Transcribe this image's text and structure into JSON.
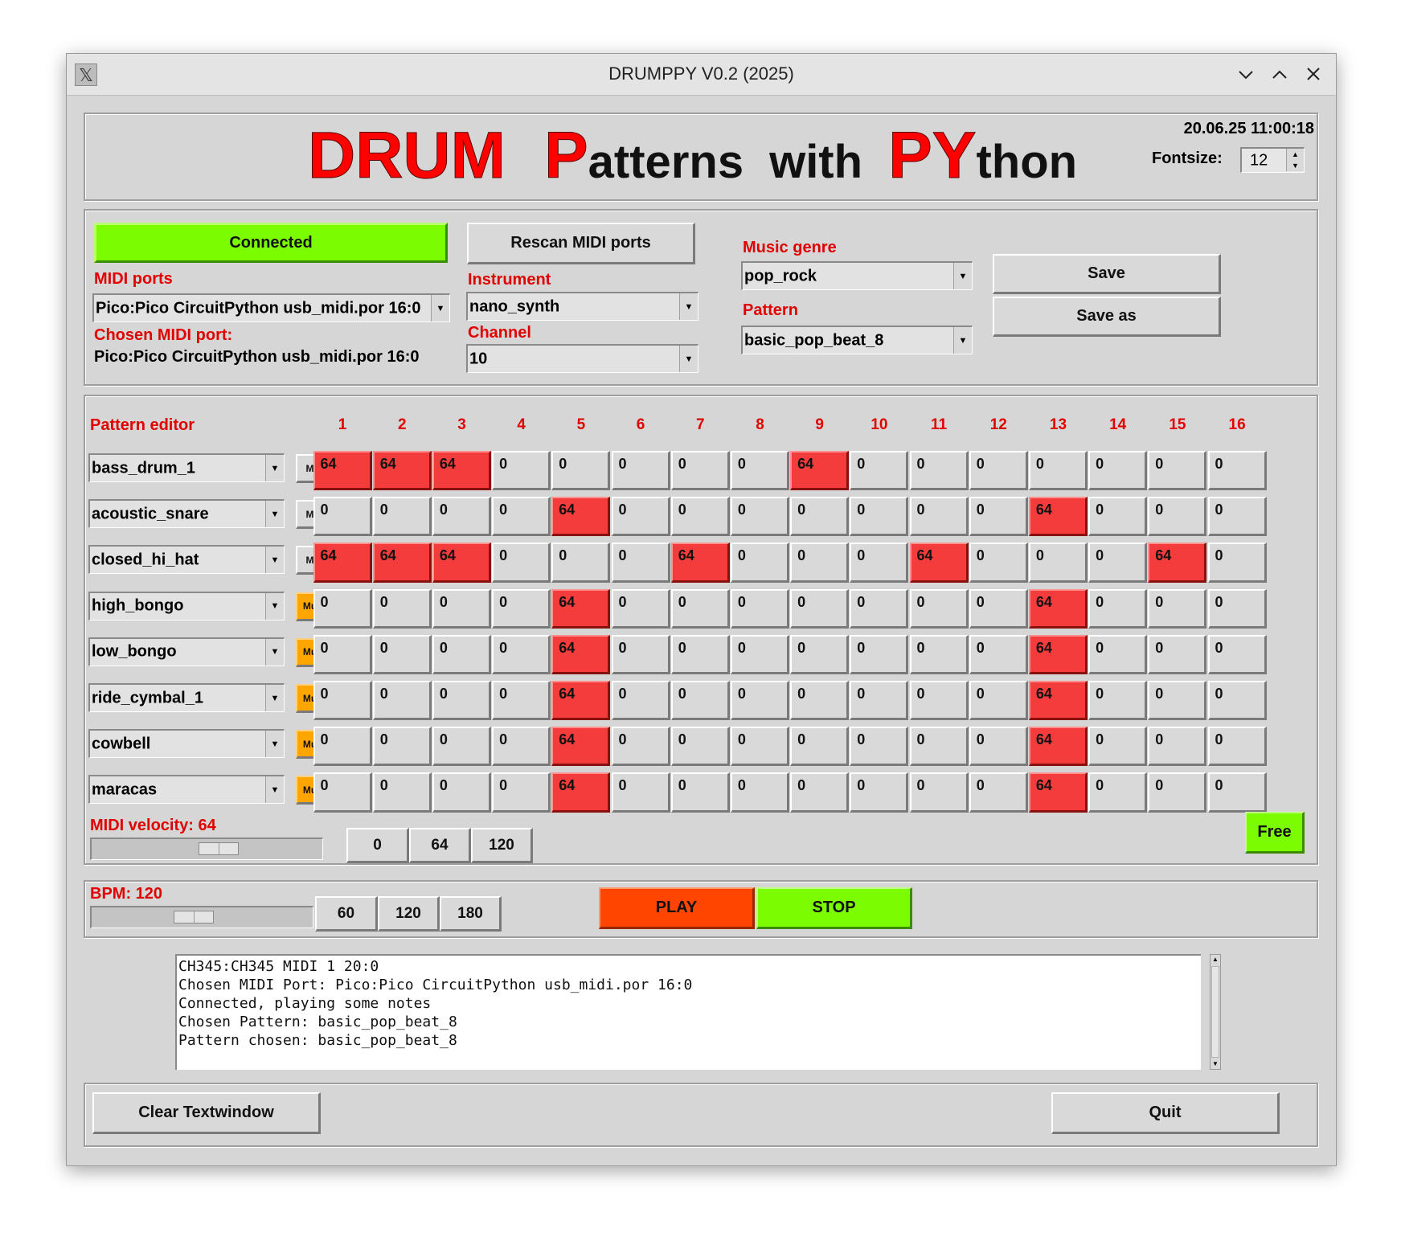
{
  "window": {
    "title": "DRUMPPY V0.2 (2025)"
  },
  "header": {
    "title_parts": [
      "DRUM",
      "P",
      "atterns",
      "with",
      "PY",
      "thon"
    ],
    "datetime": "20.06.25 11:00:18",
    "fontsize_label": "Fontsize:",
    "fontsize_value": "12"
  },
  "midi": {
    "status": "Connected",
    "status_color": "#7cfc00",
    "ports_label": "MIDI ports",
    "port_selected": "Pico:Pico CircuitPython usb_midi.por 16:0",
    "chosen_label": "Chosen MIDI port:",
    "chosen_value": "Pico:Pico CircuitPython usb_midi.por 16:0",
    "rescan_label": "Rescan MIDI ports",
    "instrument_label": "Instrument",
    "instrument_value": "nano_synth",
    "channel_label": "Channel",
    "channel_value": "10",
    "genre_label": "Music genre",
    "genre_value": "pop_rock",
    "pattern_label": "Pattern",
    "pattern_value": "basic_pop_beat_8",
    "save_label": "Save",
    "save_as_label": "Save as"
  },
  "editor": {
    "label": "Pattern editor",
    "columns": [
      "1",
      "2",
      "3",
      "4",
      "5",
      "6",
      "7",
      "8",
      "9",
      "10",
      "11",
      "12",
      "13",
      "14",
      "15",
      "16"
    ],
    "rows": [
      {
        "instrument": "bass_drum_1",
        "mute": "Mute",
        "steps": [
          64,
          64,
          64,
          0,
          0,
          0,
          0,
          0,
          64,
          0,
          0,
          0,
          0,
          0,
          0,
          0
        ]
      },
      {
        "instrument": "acoustic_snare",
        "mute": "Mute",
        "steps": [
          0,
          0,
          0,
          0,
          64,
          0,
          0,
          0,
          0,
          0,
          0,
          0,
          64,
          0,
          0,
          0
        ]
      },
      {
        "instrument": "closed_hi_hat",
        "mute": "Mute",
        "steps": [
          64,
          64,
          64,
          0,
          0,
          0,
          64,
          0,
          0,
          0,
          64,
          0,
          0,
          0,
          64,
          0
        ]
      },
      {
        "instrument": "high_bongo",
        "mute": "Muted",
        "steps": [
          0,
          0,
          0,
          0,
          64,
          0,
          0,
          0,
          0,
          0,
          0,
          0,
          64,
          0,
          0,
          0
        ]
      },
      {
        "instrument": "low_bongo",
        "mute": "Muted",
        "steps": [
          0,
          0,
          0,
          0,
          64,
          0,
          0,
          0,
          0,
          0,
          0,
          0,
          64,
          0,
          0,
          0
        ]
      },
      {
        "instrument": "ride_cymbal_1",
        "mute": "Muted",
        "steps": [
          0,
          0,
          0,
          0,
          64,
          0,
          0,
          0,
          0,
          0,
          0,
          0,
          64,
          0,
          0,
          0
        ]
      },
      {
        "instrument": "cowbell",
        "mute": "Muted",
        "steps": [
          0,
          0,
          0,
          0,
          64,
          0,
          0,
          0,
          0,
          0,
          0,
          0,
          64,
          0,
          0,
          0
        ]
      },
      {
        "instrument": "maracas",
        "mute": "Muted",
        "steps": [
          0,
          0,
          0,
          0,
          64,
          0,
          0,
          0,
          0,
          0,
          0,
          0,
          64,
          0,
          0,
          0
        ]
      }
    ],
    "velocity_label": "MIDI velocity: 64",
    "velocity_presets": [
      "0",
      "64",
      "120"
    ],
    "free_label": "Free"
  },
  "transport": {
    "bpm_label": "BPM: 120",
    "bpm_presets": [
      "60",
      "120",
      "180"
    ],
    "play_label": "PLAY",
    "stop_label": "STOP",
    "play_color": "#ff4500",
    "stop_color": "#7cfc00"
  },
  "log": {
    "lines": [
      "CH345:CH345 MIDI 1 20:0",
      "Chosen MIDI Port: Pico:Pico CircuitPython usb_midi.por 16:0",
      "Connected, playing some notes",
      "Chosen Pattern: basic_pop_beat_8",
      "Pattern chosen: basic_pop_beat_8"
    ]
  },
  "footer": {
    "clear_label": "Clear Textwindow",
    "quit_label": "Quit"
  }
}
